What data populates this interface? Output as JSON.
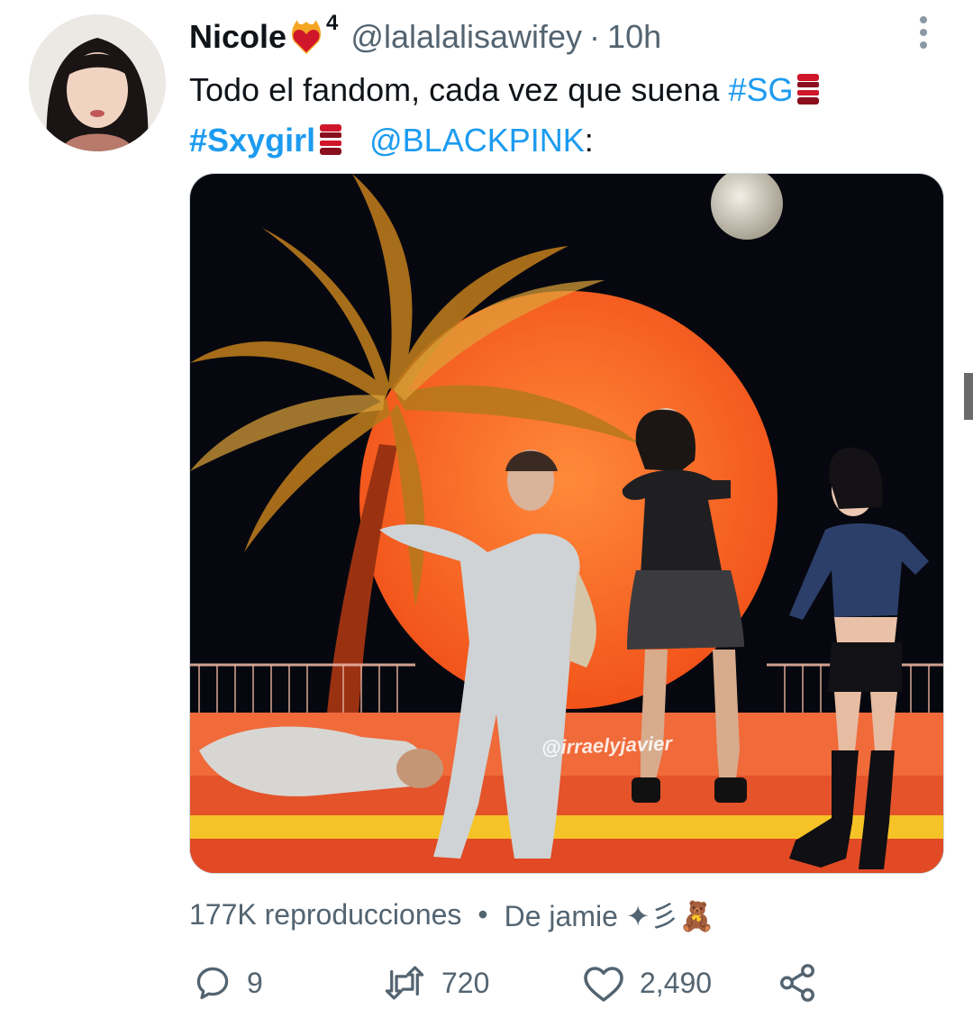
{
  "tweet": {
    "author_name": "Nicole",
    "badge_number": "4",
    "handle": "@lalalalisawifey",
    "separator": "·",
    "time": "10h",
    "text_line1": "Todo el fandom, cada vez que suena",
    "hashtag1": "#SG",
    "hashtag2": "#Sxygirl",
    "mention": "@BLACKPINK",
    "colon": ":",
    "media": {
      "watermark": "@irraelyjavier"
    },
    "views_text": "177K reproducciones",
    "views_sep": "•",
    "source_text": "De jamie ✦彡🧸",
    "stats": {
      "replies": "9",
      "retweets": "720",
      "likes": "2,490"
    }
  },
  "icons": {
    "reply": "reply-icon",
    "retweet": "retweet-icon",
    "like": "heart-icon",
    "share": "share-icon",
    "more": "more-vertical-icon"
  },
  "colors": {
    "link": "#1d9bf0",
    "secondary": "#536471"
  }
}
